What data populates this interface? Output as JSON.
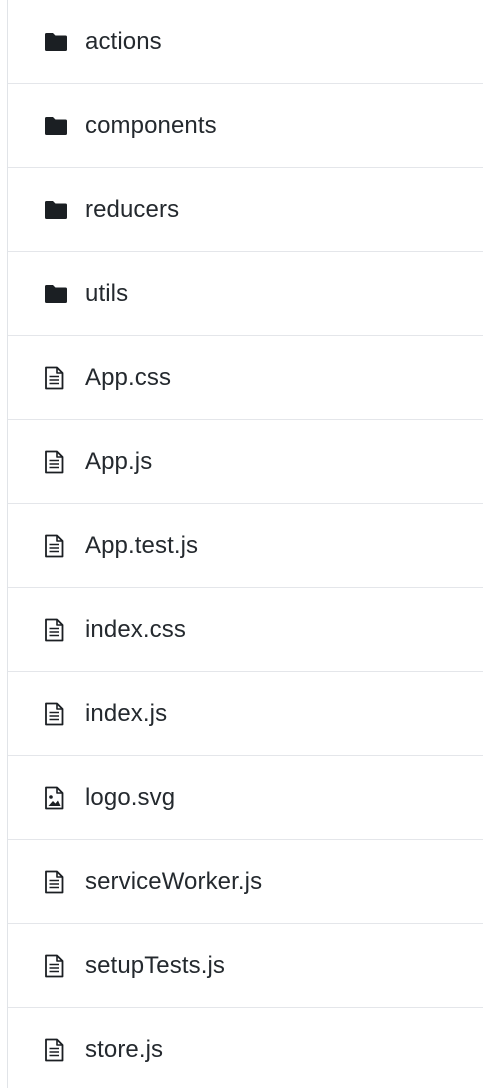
{
  "file_list": {
    "items": [
      {
        "name": "actions",
        "type": "folder",
        "icon": "folder-icon"
      },
      {
        "name": "components",
        "type": "folder",
        "icon": "folder-icon"
      },
      {
        "name": "reducers",
        "type": "folder",
        "icon": "folder-icon"
      },
      {
        "name": "utils",
        "type": "folder",
        "icon": "folder-icon"
      },
      {
        "name": "App.css",
        "type": "file",
        "icon": "file-text-icon"
      },
      {
        "name": "App.js",
        "type": "file",
        "icon": "file-text-icon"
      },
      {
        "name": "App.test.js",
        "type": "file",
        "icon": "file-text-icon"
      },
      {
        "name": "index.css",
        "type": "file",
        "icon": "file-text-icon"
      },
      {
        "name": "index.js",
        "type": "file",
        "icon": "file-text-icon"
      },
      {
        "name": "logo.svg",
        "type": "image",
        "icon": "file-image-icon"
      },
      {
        "name": "serviceWorker.js",
        "type": "file",
        "icon": "file-text-icon"
      },
      {
        "name": "setupTests.js",
        "type": "file",
        "icon": "file-text-icon"
      },
      {
        "name": "store.js",
        "type": "file",
        "icon": "file-text-icon"
      }
    ]
  },
  "colors": {
    "text": "#24292e",
    "icon": "#1b1f23",
    "divider": "#e4e6ea"
  }
}
